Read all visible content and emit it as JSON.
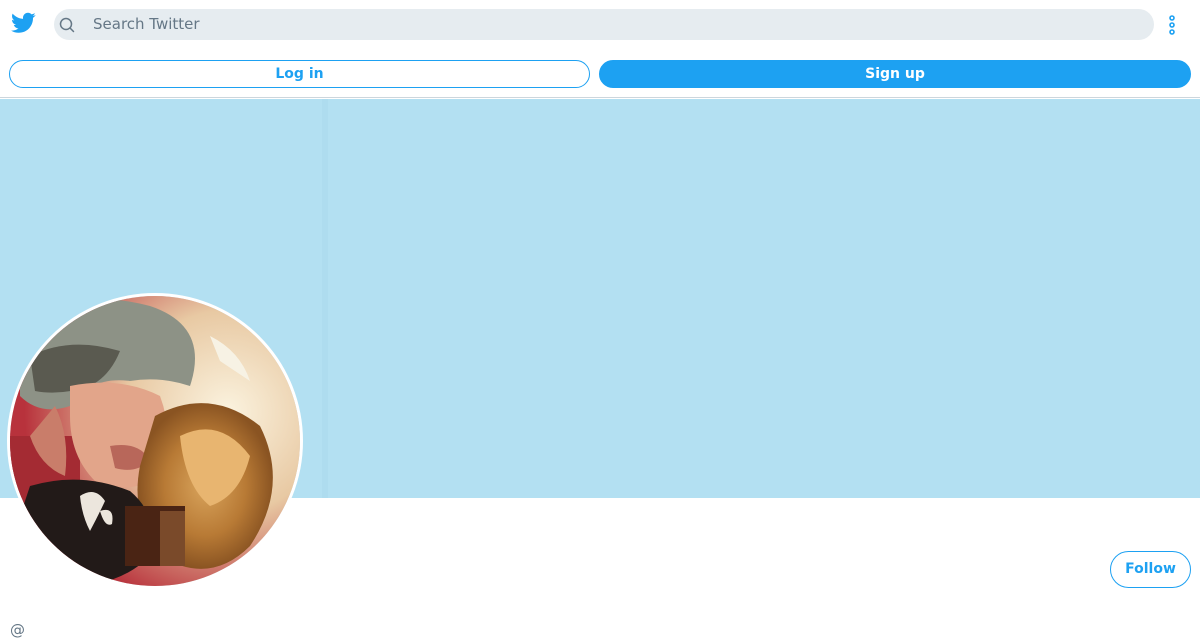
{
  "header": {
    "logo_icon": "twitter-bird-icon",
    "search_placeholder": "Search Twitter",
    "more_icon": "vertical-ellipsis-icon",
    "brand_color": "#1da1f2"
  },
  "auth": {
    "login_label": "Log in",
    "signup_label": "Sign up"
  },
  "profile": {
    "banner_color": "#b3e0f2",
    "avatar_alt": "profile photo",
    "follow_label": "Follow",
    "handle": "@"
  }
}
